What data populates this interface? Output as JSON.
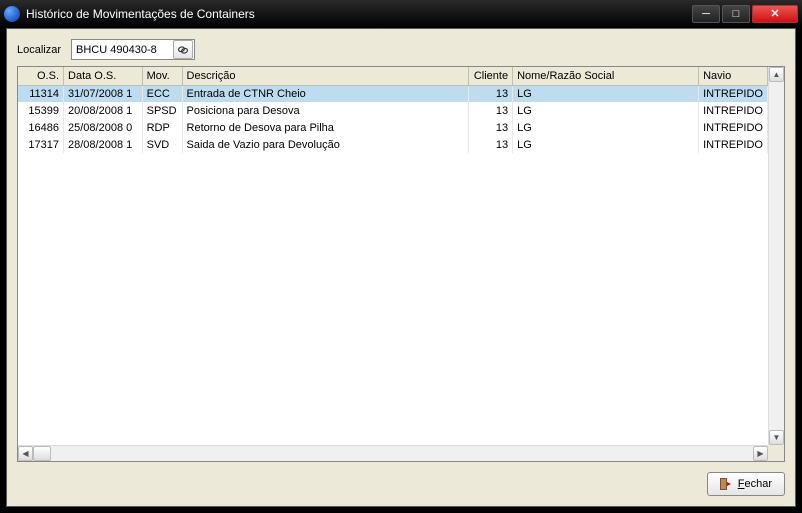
{
  "window": {
    "title": "Histórico de Movimentações de Containers"
  },
  "toolbar": {
    "localizar_label": "Localizar",
    "search_value": "BHCU 490430-8"
  },
  "grid": {
    "columns": {
      "os": "O.S.",
      "data": "Data O.S.",
      "mov": "Mov.",
      "descricao": "Descrição",
      "cliente": "Cliente",
      "nome": "Nome/Razão Social",
      "navio": "Navio"
    },
    "rows": [
      {
        "os": "11314",
        "data": "31/07/2008 1",
        "mov": "ECC",
        "descricao": "Entrada de CTNR Cheio",
        "cliente": "13",
        "nome": "LG",
        "navio": "INTREPIDO"
      },
      {
        "os": "15399",
        "data": "20/08/2008 1",
        "mov": "SPSD",
        "descricao": "Posiciona para  Desova",
        "cliente": "13",
        "nome": "LG",
        "navio": "INTREPIDO"
      },
      {
        "os": "16486",
        "data": "25/08/2008 0",
        "mov": "RDP",
        "descricao": "Retorno de Desova para Pilha",
        "cliente": "13",
        "nome": "LG",
        "navio": "INTREPIDO"
      },
      {
        "os": "17317",
        "data": "28/08/2008 1",
        "mov": "SVD",
        "descricao": "Saida de Vazio para Devolução",
        "cliente": "13",
        "nome": "LG",
        "navio": "INTREPIDO"
      }
    ]
  },
  "buttons": {
    "fechar_prefix": "F",
    "fechar_suffix": "echar"
  }
}
